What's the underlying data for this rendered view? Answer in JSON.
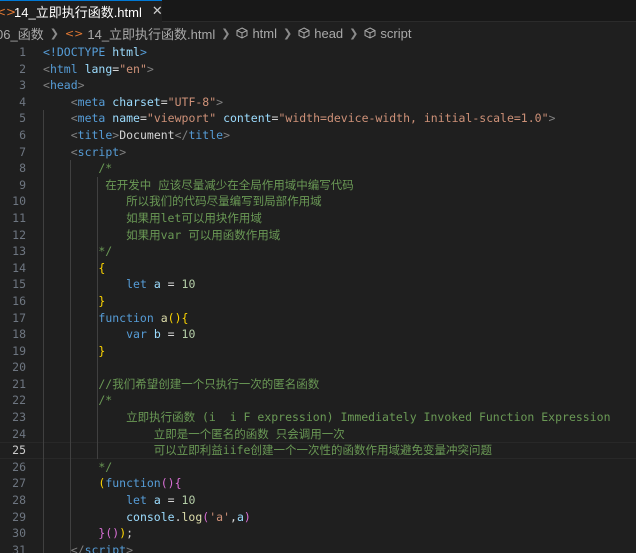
{
  "tab": {
    "icon": "html-file-icon",
    "label": "14_立即执行函数.html",
    "close": "✕"
  },
  "breadcrumb": {
    "folder": "06_函数",
    "file": "14_立即执行函数.html",
    "html": "html",
    "head": "head",
    "script": "script"
  },
  "editor": {
    "active_line": 25,
    "line_numbers": [
      "1",
      "2",
      "3",
      "4",
      "5",
      "6",
      "7",
      "8",
      "9",
      "10",
      "11",
      "12",
      "13",
      "14",
      "15",
      "16",
      "17",
      "18",
      "19",
      "20",
      "21",
      "22",
      "23",
      "24",
      "25",
      "26",
      "27",
      "28",
      "29",
      "30",
      "31"
    ],
    "lines": [
      [
        {
          "t": "<!DOCTYPE ",
          "c": "t-tag"
        },
        {
          "t": "html",
          "c": "t-attr"
        },
        {
          "t": ">",
          "c": "t-tag"
        }
      ],
      [
        {
          "t": "<",
          "c": "t-punct"
        },
        {
          "t": "html",
          "c": "t-tag"
        },
        {
          "t": " lang",
          "c": "t-attr"
        },
        {
          "t": "=",
          "c": "t-text"
        },
        {
          "t": "\"en\"",
          "c": "t-str"
        },
        {
          "t": ">",
          "c": "t-punct"
        }
      ],
      [
        {
          "t": "<",
          "c": "t-punct"
        },
        {
          "t": "head",
          "c": "t-tag"
        },
        {
          "t": ">",
          "c": "t-punct"
        }
      ],
      [
        {
          "t": "    ",
          "c": "t-text"
        },
        {
          "t": "<",
          "c": "t-punct"
        },
        {
          "t": "meta",
          "c": "t-tag"
        },
        {
          "t": " charset",
          "c": "t-attr"
        },
        {
          "t": "=",
          "c": "t-text"
        },
        {
          "t": "\"UTF-8\"",
          "c": "t-str"
        },
        {
          "t": ">",
          "c": "t-punct"
        }
      ],
      [
        {
          "t": "    ",
          "c": "t-text"
        },
        {
          "t": "<",
          "c": "t-punct"
        },
        {
          "t": "meta",
          "c": "t-tag"
        },
        {
          "t": " name",
          "c": "t-attr"
        },
        {
          "t": "=",
          "c": "t-text"
        },
        {
          "t": "\"viewport\"",
          "c": "t-str"
        },
        {
          "t": " content",
          "c": "t-attr"
        },
        {
          "t": "=",
          "c": "t-text"
        },
        {
          "t": "\"width=device-width, initial-scale=1.0\"",
          "c": "t-str"
        },
        {
          "t": ">",
          "c": "t-punct"
        }
      ],
      [
        {
          "t": "    ",
          "c": "t-text"
        },
        {
          "t": "<",
          "c": "t-punct"
        },
        {
          "t": "title",
          "c": "t-tag"
        },
        {
          "t": ">",
          "c": "t-punct"
        },
        {
          "t": "Document",
          "c": "t-text"
        },
        {
          "t": "</",
          "c": "t-punct"
        },
        {
          "t": "title",
          "c": "t-tag"
        },
        {
          "t": ">",
          "c": "t-punct"
        }
      ],
      [
        {
          "t": "    ",
          "c": "t-text"
        },
        {
          "t": "<",
          "c": "t-punct"
        },
        {
          "t": "script",
          "c": "t-tag"
        },
        {
          "t": ">",
          "c": "t-punct"
        }
      ],
      [
        {
          "t": "        /*",
          "c": "t-comment"
        }
      ],
      [
        {
          "t": "         在开发中 应该尽量减少在全局作用域中编写代码",
          "c": "t-comment"
        }
      ],
      [
        {
          "t": "            所以我们的代码尽量编写到局部作用域",
          "c": "t-comment"
        }
      ],
      [
        {
          "t": "            如果用let可以用块作用域",
          "c": "t-comment"
        }
      ],
      [
        {
          "t": "            如果用var 可以用函数作用域",
          "c": "t-comment"
        }
      ],
      [
        {
          "t": "        */",
          "c": "t-comment"
        }
      ],
      [
        {
          "t": "        ",
          "c": "t-text"
        },
        {
          "t": "{",
          "c": "t-b1"
        }
      ],
      [
        {
          "t": "            ",
          "c": "t-text"
        },
        {
          "t": "let",
          "c": "t-kw"
        },
        {
          "t": " ",
          "c": "t-text"
        },
        {
          "t": "a",
          "c": "t-var"
        },
        {
          "t": " = ",
          "c": "t-op"
        },
        {
          "t": "10",
          "c": "t-num"
        }
      ],
      [
        {
          "t": "        ",
          "c": "t-text"
        },
        {
          "t": "}",
          "c": "t-b1"
        }
      ],
      [
        {
          "t": "        ",
          "c": "t-text"
        },
        {
          "t": "function",
          "c": "t-kw"
        },
        {
          "t": " ",
          "c": "t-text"
        },
        {
          "t": "a",
          "c": "t-fn"
        },
        {
          "t": "()",
          "c": "t-b1"
        },
        {
          "t": "{",
          "c": "t-b1"
        }
      ],
      [
        {
          "t": "            ",
          "c": "t-text"
        },
        {
          "t": "var",
          "c": "t-kw"
        },
        {
          "t": " ",
          "c": "t-text"
        },
        {
          "t": "b",
          "c": "t-var"
        },
        {
          "t": " = ",
          "c": "t-op"
        },
        {
          "t": "10",
          "c": "t-num"
        }
      ],
      [
        {
          "t": "        ",
          "c": "t-text"
        },
        {
          "t": "}",
          "c": "t-b1"
        }
      ],
      [],
      [
        {
          "t": "        //我们希望创建一个只执行一次的匿名函数",
          "c": "t-comment"
        }
      ],
      [
        {
          "t": "        /*",
          "c": "t-comment"
        }
      ],
      [
        {
          "t": "            立即执行函数 (i  i F expression) Immediately Invoked Function Expression",
          "c": "t-comment"
        }
      ],
      [
        {
          "t": "                立即是一个匿名的函数 只会调用一次",
          "c": "t-comment"
        }
      ],
      [
        {
          "t": "                可以立即利益iife创建一个一次性的函数作用域避免变量冲突问题",
          "c": "t-comment"
        }
      ],
      [
        {
          "t": "        */",
          "c": "t-comment"
        }
      ],
      [
        {
          "t": "        ",
          "c": "t-text"
        },
        {
          "t": "(",
          "c": "t-b1"
        },
        {
          "t": "function",
          "c": "t-kw"
        },
        {
          "t": "()",
          "c": "t-b2"
        },
        {
          "t": "{",
          "c": "t-b2"
        }
      ],
      [
        {
          "t": "            ",
          "c": "t-text"
        },
        {
          "t": "let",
          "c": "t-kw"
        },
        {
          "t": " ",
          "c": "t-text"
        },
        {
          "t": "a",
          "c": "t-var"
        },
        {
          "t": " = ",
          "c": "t-op"
        },
        {
          "t": "10",
          "c": "t-num"
        }
      ],
      [
        {
          "t": "            ",
          "c": "t-text"
        },
        {
          "t": "console",
          "c": "t-var"
        },
        {
          "t": ".",
          "c": "t-op"
        },
        {
          "t": "log",
          "c": "t-fn"
        },
        {
          "t": "(",
          "c": "t-b2"
        },
        {
          "t": "'a'",
          "c": "t-str"
        },
        {
          "t": ",",
          "c": "t-op"
        },
        {
          "t": "a",
          "c": "t-var"
        },
        {
          "t": ")",
          "c": "t-b2"
        }
      ],
      [
        {
          "t": "        ",
          "c": "t-text"
        },
        {
          "t": "}",
          "c": "t-b2"
        },
        {
          "t": "()",
          "c": "t-b2"
        },
        {
          "t": ")",
          "c": "t-b1"
        },
        {
          "t": ";",
          "c": "t-op"
        }
      ],
      [
        {
          "t": "    ",
          "c": "t-text"
        },
        {
          "t": "</",
          "c": "t-punct"
        },
        {
          "t": "script",
          "c": "t-tag"
        },
        {
          "t": ">",
          "c": "t-punct"
        }
      ]
    ]
  }
}
